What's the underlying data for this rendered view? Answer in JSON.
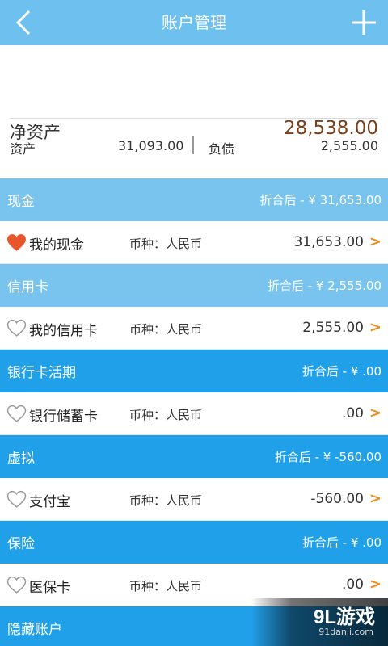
{
  "header": {
    "title": "账户管理",
    "back_icon": "chevron-left-icon",
    "add_icon": "plus-icon"
  },
  "summary": {
    "net_label": "净资产",
    "net_value": "28,538.00",
    "asset_label": "资产",
    "asset_value": "31,093.00",
    "debt_label": "负债",
    "debt_value": "2,555.00"
  },
  "groups": [
    {
      "name": "现金",
      "total": "折合后 - ¥  31,653.00",
      "style": "light",
      "account": {
        "name": "我的现金",
        "currency": "币种：人民币",
        "amount": "31,653.00",
        "favorite": true
      }
    },
    {
      "name": "信用卡",
      "total": "折合后 - ¥  2,555.00",
      "style": "light",
      "account": {
        "name": "我的信用卡",
        "currency": "币种：人民币",
        "amount": "2,555.00",
        "favorite": false
      }
    },
    {
      "name": "银行卡活期",
      "total": "折合后 - ¥  .00",
      "style": "dark",
      "account": {
        "name": "银行储蓄卡",
        "currency": "币种：人民币",
        "amount": ".00",
        "favorite": false
      }
    },
    {
      "name": "虚拟",
      "total": "折合后 - ¥  -560.00",
      "style": "dark",
      "account": {
        "name": "支付宝",
        "currency": "币种：人民币",
        "amount": "-560.00",
        "favorite": false
      }
    },
    {
      "name": "保险",
      "total": "折合后 - ¥  .00",
      "style": "dark",
      "account": {
        "name": "医保卡",
        "currency": "币种：人民币",
        "amount": ".00",
        "favorite": false
      }
    },
    {
      "name": "隐藏账户",
      "total": "",
      "style": "dark",
      "account": null
    }
  ],
  "chevron": ">",
  "colors": {
    "header_bg": "#6ec1ee",
    "group_light": "#78c4ee",
    "group_dark": "#21a0ea",
    "net_value": "#7a3e18",
    "heart_filled": "#e8552a",
    "chevron": "#f08a1c"
  },
  "watermark": {
    "main": "9L游戏",
    "sub": "91danji.com"
  }
}
